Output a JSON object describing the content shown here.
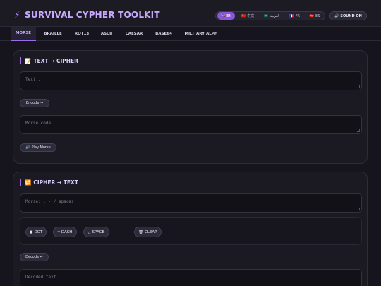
{
  "header": {
    "title": "SURVIVAL CYPHER TOOLKIT",
    "title_icon": "lightning-icon",
    "languages": [
      {
        "flag": "🇬🇧",
        "label": "EN",
        "active": true
      },
      {
        "flag": "🇨🇳",
        "label": "中文",
        "active": false
      },
      {
        "flag": "🇸🇦",
        "label": "العربية",
        "active": false
      },
      {
        "flag": "🇫🇷",
        "label": "FR",
        "active": false
      },
      {
        "flag": "🇪🇸",
        "label": "ES",
        "active": false
      }
    ],
    "sound_icon": "🔊",
    "sound_label": "SOUND ON"
  },
  "tabs": [
    {
      "label": "MORSE",
      "active": true
    },
    {
      "label": "BRAILLE",
      "active": false
    },
    {
      "label": "ROT13",
      "active": false
    },
    {
      "label": "ASCII",
      "active": false
    },
    {
      "label": "CAESAR",
      "active": false
    },
    {
      "label": "BASE64",
      "active": false
    },
    {
      "label": "MILITARY ALPH",
      "active": false
    }
  ],
  "encode_panel": {
    "icon": "📝",
    "title": "TEXT → CIPHER",
    "input_placeholder": "Text...",
    "encode_label": "Encode →",
    "output_placeholder": "Morse code",
    "play_icon": "🔊",
    "play_label": "Play Morse"
  },
  "decode_panel": {
    "icon": "🔁",
    "title": "CIPHER → TEXT",
    "input_placeholder": "Morse: . - / spaces",
    "keypad": [
      {
        "icon": "●",
        "label": "DOT"
      },
      {
        "icon": "━",
        "label": "DASH"
      },
      {
        "icon": "␣",
        "label": "SPACE"
      },
      {
        "icon": "🗑",
        "label": "CLEAR"
      }
    ],
    "decode_label": "Decode ←",
    "output_placeholder": "Decoded text"
  },
  "colors": {
    "accent": "#9c6cf0",
    "background": "#16151d",
    "card": "#1b1a23"
  }
}
